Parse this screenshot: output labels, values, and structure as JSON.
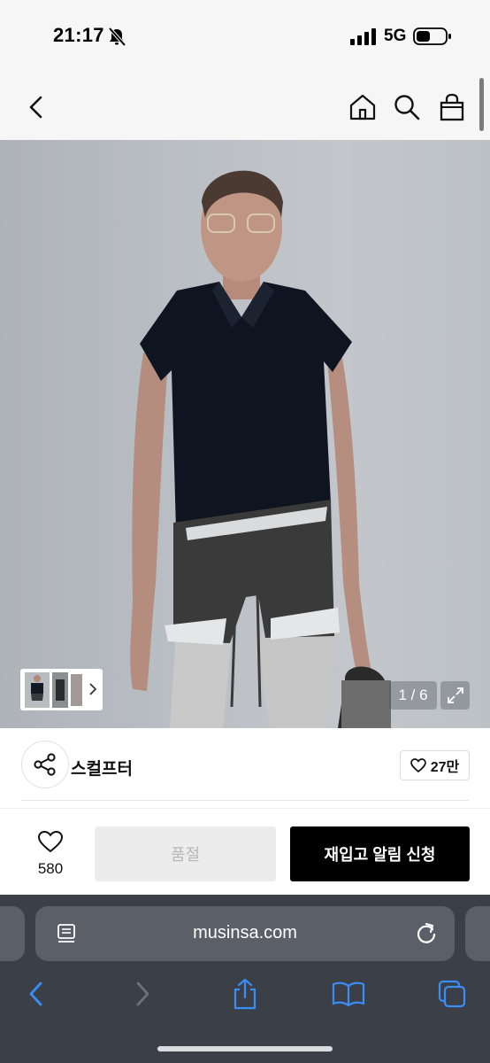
{
  "status_bar": {
    "time": "21:17",
    "network": "5G"
  },
  "product": {
    "page_counter": "1 / 6"
  },
  "brand": {
    "name": "스컬프터",
    "like_count": "27만"
  },
  "actions": {
    "wish_count": "580",
    "soldout_label": "품절",
    "restock_label": "재입고 알림 신청"
  },
  "browser": {
    "url": "musinsa.com"
  },
  "icons": {
    "status": [
      "mute-icon",
      "signal-icon",
      "battery-icon"
    ],
    "nav": [
      "back-icon",
      "home-icon",
      "search-icon",
      "bag-icon"
    ],
    "safari": [
      "reader-icon",
      "reload-icon",
      "back-icon",
      "forward-icon",
      "share-icon",
      "bookmarks-icon",
      "tabs-icon"
    ]
  },
  "colors": {
    "restock_button": "#000000",
    "soldout_button": "#ececec",
    "safari_accent": "#3b8df6",
    "safari_bg": "#3b4048"
  }
}
